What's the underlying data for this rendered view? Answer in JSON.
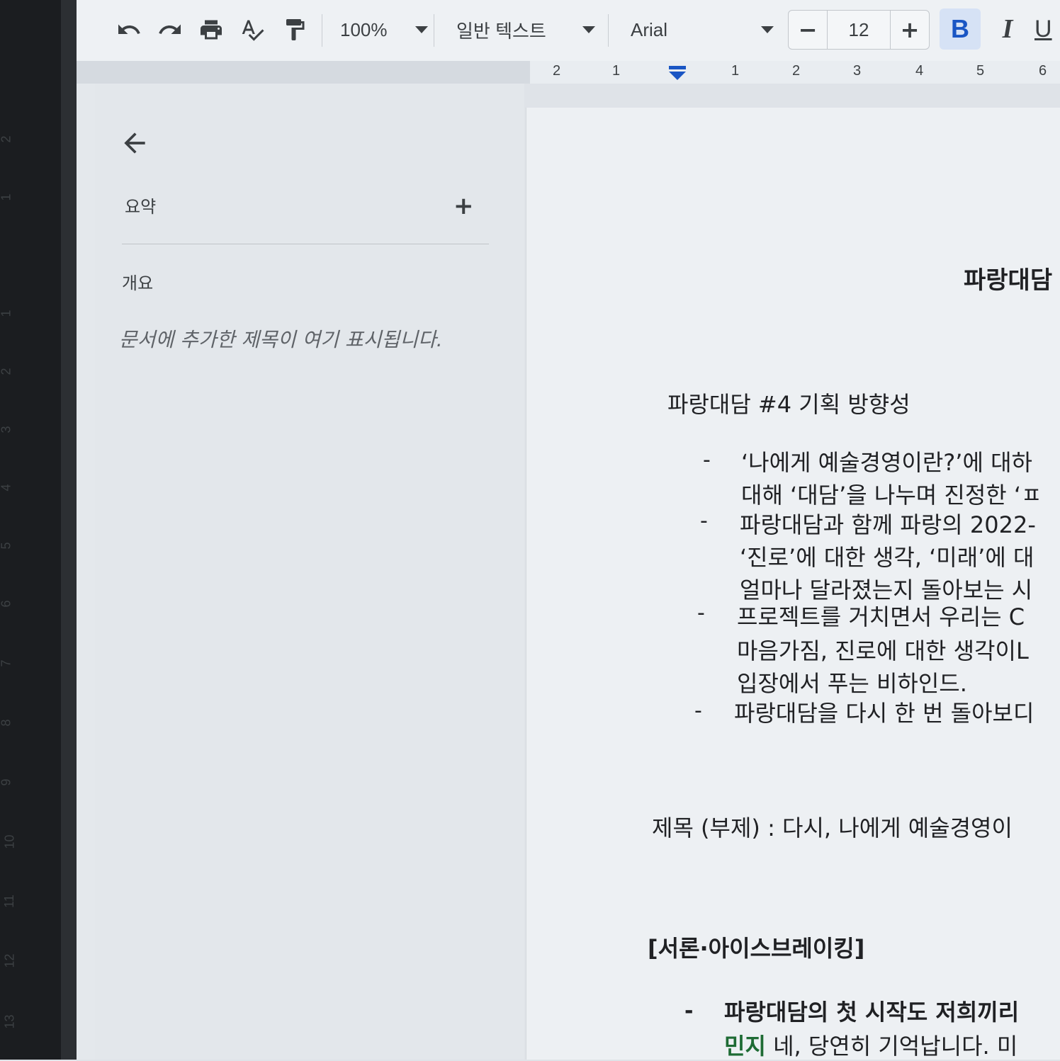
{
  "toolbar": {
    "zoom": "100%",
    "style": "일반 텍스트",
    "font": "Arial",
    "font_size": "12",
    "minus": "−",
    "plus": "+",
    "bold": "B",
    "italic": "I",
    "underline": "U"
  },
  "ruler": {
    "horizontal": [
      "2",
      "1",
      "1",
      "2",
      "3",
      "4",
      "5",
      "6"
    ],
    "vertical": [
      "2",
      "1",
      "1",
      "2",
      "3",
      "4",
      "5",
      "6",
      "7",
      "8",
      "9",
      "10",
      "11",
      "12",
      "13"
    ]
  },
  "sidebar": {
    "summary_label": "요약",
    "add": "+",
    "outline_label": "개요",
    "outline_hint": "문서에 추가한 제목이 여기 표시됩니다."
  },
  "document": {
    "title": "파랑대담",
    "heading": "파랑대담 #4 기획 방향성",
    "bullets": [
      [
        "‘나에게 예술경영이란?’에 대하",
        "대해 ‘대담’을 나누며 진정한 ‘ㅍ"
      ],
      [
        "파랑대담과 함께 파랑의 2022-",
        "‘진로’에 대한 생각, ‘미래’에 대",
        "얼마나 달라졌는지 돌아보는 시"
      ],
      [
        "프로젝트를 거치면서 우리는 C",
        "마음가짐, 진로에 대한 생각이L",
        "입장에서 푸는 비하인드."
      ],
      [
        "파랑대담을 다시 한 번 돌아보디"
      ]
    ],
    "bullet_marker": "-",
    "subtitle": "제목 (부제) : 다시, 나에게 예술경영이",
    "section": "[서론·아이스브레이킹]",
    "section_bullet": "파랑대담의 첫 시작도 저희끼리",
    "speaker": "민지",
    "speaker_text": " 네, 당연히 기억납니다. 미"
  }
}
